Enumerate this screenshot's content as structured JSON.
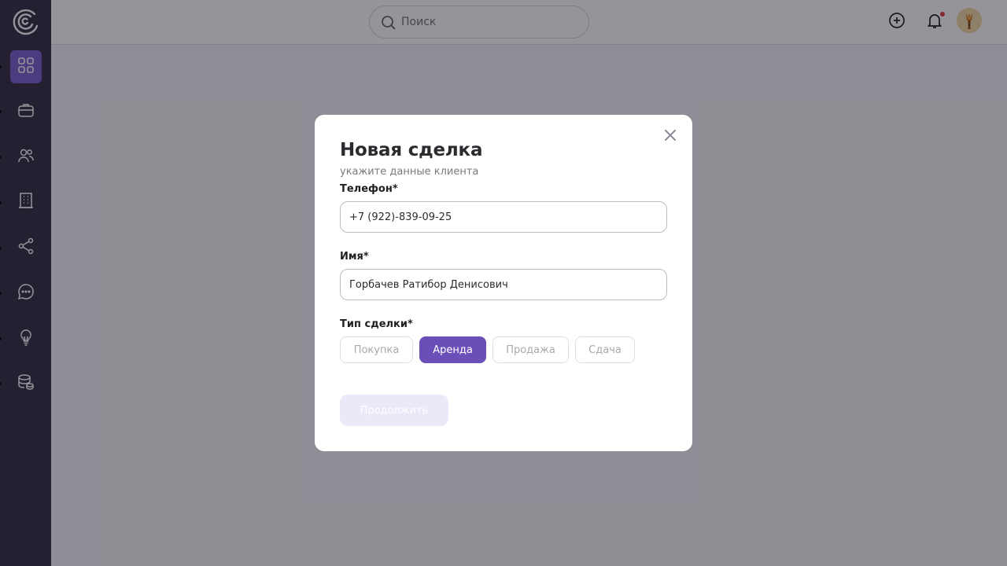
{
  "search": {
    "placeholder": "Поиск"
  },
  "sidebar": {
    "items": [
      {
        "icon": "dashboard-icon",
        "active": true
      },
      {
        "icon": "briefcase-icon",
        "active": false
      },
      {
        "icon": "users-icon",
        "active": false
      },
      {
        "icon": "building-icon",
        "active": false
      },
      {
        "icon": "share-icon",
        "active": false
      },
      {
        "icon": "chat-icon",
        "active": false
      },
      {
        "icon": "lightbulb-icon",
        "active": false
      },
      {
        "icon": "database-icon",
        "active": false
      }
    ]
  },
  "modal": {
    "title": "Новая сделка",
    "subtitle": "укажите данные клиента",
    "phone": {
      "label": "Телефон*",
      "value": "+7 (922)-839-09-25"
    },
    "name": {
      "label": "Имя*",
      "value": "Горбачев Ратибор Денисович"
    },
    "deal_type": {
      "label": "Тип сделки*",
      "options": [
        "Покупка",
        "Аренда",
        "Продажа",
        "Сдача"
      ],
      "selected": "Аренда"
    },
    "continue_label": "Продолжить"
  },
  "colors": {
    "sidebar": "#322c44",
    "accent": "#6a4fb8",
    "active_nav": "#7b5fd0",
    "disabled_button": "#ebe8f8"
  }
}
